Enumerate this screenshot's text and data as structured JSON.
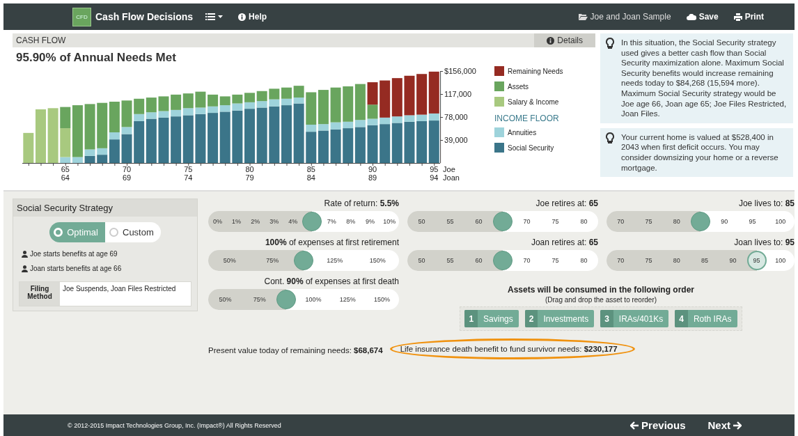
{
  "nav": {
    "logo": "CFD",
    "title": "Cash Flow Decisions",
    "help": "Help",
    "client": "Joe and Joan Sample",
    "save": "Save",
    "print": "Print"
  },
  "cash_flow": {
    "header": "CASH FLOW",
    "details_button": "Details",
    "title": "95.90% of Annual Needs Met",
    "legend": [
      {
        "kind": "item"
      },
      {
        "kind": "item"
      },
      {
        "kind": "item"
      },
      {
        "kind": "heading",
        "text": "INCOME FLOOR"
      },
      {
        "kind": "item"
      },
      {
        "kind": "item"
      }
    ],
    "age_rows": [
      {
        "name": "Joe"
      },
      {
        "name": "Joan",
        "labels": [
          "64",
          "69",
          "74",
          "79",
          "84",
          "89",
          "94"
        ]
      }
    ],
    "chart_data": {
      "type": "bar",
      "stacked": true,
      "x": [
        62,
        63,
        64,
        65,
        66,
        67,
        68,
        69,
        70,
        71,
        72,
        73,
        74,
        75,
        76,
        77,
        78,
        79,
        80,
        81,
        82,
        83,
        84,
        85,
        86,
        87,
        88,
        89,
        90,
        91,
        92,
        93,
        94,
        95
      ],
      "xlim": [
        61.5,
        95.5
      ],
      "xticks": [
        65,
        70,
        75,
        80,
        85,
        90,
        95
      ],
      "ylim": [
        0,
        156000
      ],
      "yticks": [
        {
          "value": 156000,
          "label": "$156,000"
        },
        {
          "value": 117000,
          "label": "117,000"
        },
        {
          "value": 78000,
          "label": "78,000"
        },
        {
          "value": 39000,
          "label": "39,000"
        }
      ],
      "series": [
        {
          "name": "Social Security",
          "color": "#3b7589",
          "values": [
            0,
            0,
            0,
            0,
            0,
            12000,
            14000,
            40000,
            49000,
            71000,
            75000,
            77000,
            79000,
            81000,
            83000,
            85000,
            87000,
            89000,
            92000,
            94000,
            96000,
            98000,
            101000,
            53000,
            55000,
            57000,
            59000,
            61000,
            64000,
            66000,
            68000,
            70000,
            71000,
            72000
          ]
        },
        {
          "name": "Annuities",
          "color": "#9ed3db",
          "values": [
            0,
            0,
            0,
            10000,
            10000,
            11000,
            11000,
            12000,
            12000,
            12000,
            11000,
            11000,
            11000,
            12000,
            11000,
            11000,
            11000,
            12000,
            11000,
            11000,
            12000,
            11000,
            10000,
            12000,
            11000,
            12000,
            11000,
            12000,
            11000,
            11000,
            11000,
            11000,
            11000,
            12000
          ]
        },
        {
          "name": "Salary & Income",
          "color": "#a8c97f",
          "values": [
            51000,
            91000,
            93000,
            49000,
            0,
            0,
            0,
            0,
            0,
            0,
            0,
            0,
            0,
            0,
            0,
            0,
            0,
            0,
            0,
            0,
            0,
            0,
            0,
            0,
            0,
            0,
            0,
            0,
            0,
            0,
            0,
            0,
            0,
            0
          ]
        },
        {
          "name": "Assets",
          "color": "#69a55e",
          "values": [
            0,
            0,
            0,
            36000,
            88000,
            77000,
            77000,
            52000,
            45000,
            26000,
            25000,
            25000,
            26000,
            25000,
            27000,
            20000,
            15000,
            15000,
            16000,
            17000,
            18000,
            19000,
            20000,
            55000,
            58000,
            59000,
            60000,
            61000,
            24000,
            0,
            0,
            0,
            0,
            0
          ]
        },
        {
          "name": "Remaining Needs",
          "color": "#952b22",
          "values": [
            0,
            0,
            0,
            0,
            0,
            0,
            0,
            0,
            0,
            0,
            0,
            0,
            0,
            0,
            0,
            0,
            0,
            0,
            0,
            0,
            0,
            0,
            0,
            0,
            0,
            0,
            0,
            0,
            38000,
            63000,
            65000,
            67000,
            69000,
            71000
          ]
        }
      ]
    }
  },
  "tips": [
    {
      "text": "In this situation, the Social Security strategy used gives a better cash flow than Social Security maximization alone. Maximum Social Security benefits would increase remaining needs today to $84,268 (15,594 more). Maximum Social Security strategy would be Joe age 66, Joan age 65; Joe Files Restricted, Joan Files."
    },
    {
      "text": "Your current home is valued at $528,400 in 2043 when first deficit occurs. You may consider downsizing your home or a reverse mortgage."
    }
  ],
  "strategy": {
    "title": "Social Security Strategy",
    "options": [
      {
        "label": "Optimal",
        "selected": true
      },
      {
        "label": "Custom",
        "selected": false
      }
    ],
    "people": [
      "Joe starts benefits at age 69",
      "Joan starts benefits at age 66"
    ],
    "filing_label": "Filing Method",
    "filing_value": "Joe Suspends, Joan Files Restricted"
  },
  "sliders": [
    {
      "label": "Rate of return: **5.5%**",
      "kind": "solid",
      "level": 0.55,
      "ticks_before": [
        "0%",
        "1%",
        "2%",
        "3%",
        "4%"
      ],
      "ticks_after": [
        "7%",
        "8%",
        "9%",
        "10%"
      ]
    },
    {
      "label": "Joe retires at: **65**",
      "kind": "solid",
      "level": 0.5,
      "ticks_before": [
        "50",
        "55",
        "60"
      ],
      "ticks_after": [
        "70",
        "75",
        "80"
      ]
    },
    {
      "label": "Joe lives to: **85**",
      "kind": "solid",
      "level": 0.5,
      "ticks_before": [
        "70",
        "75",
        "80"
      ],
      "ticks_after": [
        "90",
        "95",
        "100"
      ]
    },
    {
      "label": "**100%** of expenses at first retirement",
      "kind": "solid",
      "level": 0.5,
      "ticks_before": [
        "50%",
        "75%"
      ],
      "ticks_after": [
        "125%",
        "150%"
      ]
    },
    {
      "label": "Joan retires at: **65**",
      "kind": "solid",
      "level": 0.5,
      "ticks_before": [
        "50",
        "55",
        "60"
      ],
      "ticks_after": [
        "70",
        "75",
        "80"
      ]
    },
    {
      "label": "Joan lives to: **95**",
      "kind": "outlined",
      "thumb_label": "95",
      "level": 0.833,
      "ticks_before": [
        "70",
        "75",
        "80",
        "85",
        "90"
      ],
      "ticks_after": [
        "100"
      ]
    },
    {
      "label": "Cont. **90%** of expenses at first death",
      "kind": "solid",
      "level": 0.4,
      "ticks_before": [
        "50%",
        "75%"
      ],
      "ticks_after": [
        "100%",
        "125%",
        "150%"
      ]
    }
  ],
  "assets_order": {
    "title": "Assets will be consumed in the following order",
    "hint": "(Drag and drop the asset to reorder)",
    "items": [
      {
        "number": "1",
        "label": "Savings"
      },
      {
        "number": "2",
        "label": "Investments"
      },
      {
        "number": "3",
        "label": "IRAs/401Ks"
      },
      {
        "number": "4",
        "label": "Roth IRAs"
      }
    ]
  },
  "summary": [
    {
      "text": "Present value today of remaining needs: **$68,674**",
      "highlighted": false
    },
    {
      "text": "Life insurance death benefit to fund survivor needs: **$230,177**",
      "highlighted": true
    }
  ],
  "footer": {
    "copyright": "© 2012-2015 Impact Technologies Group, Inc. (Impact®) All Rights Reserved",
    "previous": "Previous",
    "next": "Next"
  }
}
